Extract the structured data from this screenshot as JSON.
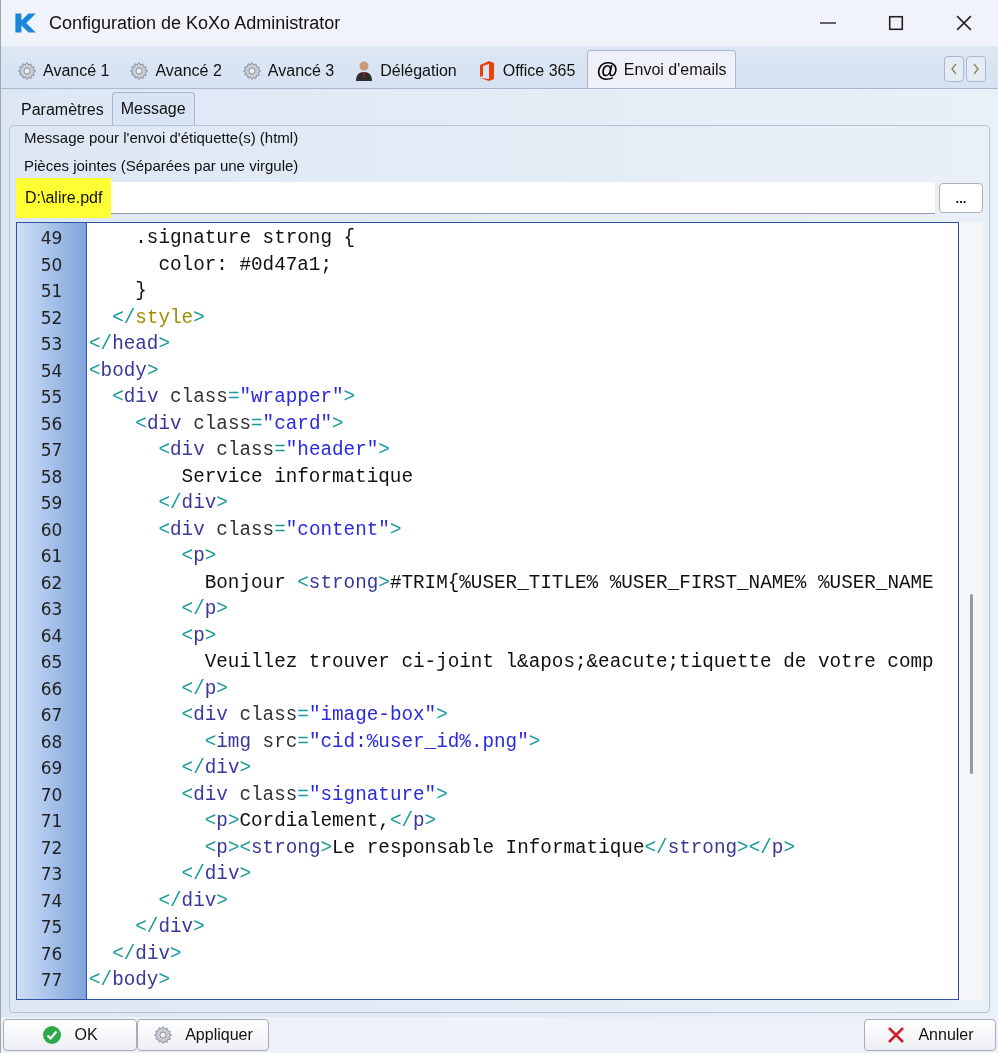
{
  "window": {
    "title": "Configuration de KoXo Administrator"
  },
  "tabs": [
    {
      "label": "Avancé 1",
      "selected": false
    },
    {
      "label": "Avancé 2",
      "selected": false
    },
    {
      "label": "Avancé 3",
      "selected": false
    },
    {
      "label": "Délégation",
      "selected": false
    },
    {
      "label": "Office 365",
      "selected": false
    },
    {
      "label": "Envoi d'emails",
      "symbol": "@",
      "selected": true
    }
  ],
  "subtabs": [
    {
      "label": "Paramètres",
      "selected": false
    },
    {
      "label": "Message",
      "selected": true
    }
  ],
  "group": {
    "title": "Message pour l'envoi d'étiquette(s) (html)"
  },
  "attachments": {
    "label": "Pièces jointes (Séparées par une virgule)",
    "value": "D:\\alire.pdf",
    "highlighted": true,
    "browse": "..."
  },
  "editor": {
    "lines": [
      {
        "n": "49",
        "kind": "markup",
        "text": "    .signature strong {"
      },
      {
        "n": "50",
        "kind": "markup",
        "text": "      color: #0d47a1;"
      },
      {
        "n": "51",
        "kind": "markup",
        "text": "    }"
      },
      {
        "n": "52",
        "kind": "style-tag",
        "text": "  </style>"
      },
      {
        "n": "53",
        "kind": "markup",
        "text": "</head>"
      },
      {
        "n": "54",
        "kind": "markup",
        "text": "<body>"
      },
      {
        "n": "55",
        "kind": "markup",
        "text": "  <div class=\"wrapper\">"
      },
      {
        "n": "56",
        "kind": "markup",
        "text": "    <div class=\"card\">"
      },
      {
        "n": "57",
        "kind": "markup",
        "text": "      <div class=\"header\">"
      },
      {
        "n": "58",
        "kind": "markup",
        "text": "        Service informatique"
      },
      {
        "n": "59",
        "kind": "markup",
        "text": "      </div>"
      },
      {
        "n": "60",
        "kind": "markup",
        "text": "      <div class=\"content\">"
      },
      {
        "n": "61",
        "kind": "markup",
        "text": "        <p>"
      },
      {
        "n": "62",
        "kind": "markup",
        "text": "          Bonjour <strong>#TRIM{%USER_TITLE% %USER_FIRST_NAME% %USER_NAME"
      },
      {
        "n": "63",
        "kind": "markup",
        "text": "        </p>"
      },
      {
        "n": "64",
        "kind": "markup",
        "text": "        <p>"
      },
      {
        "n": "65",
        "kind": "markup",
        "text": "          Veuillez trouver ci-joint l&apos;&eacute;tiquette de votre comp"
      },
      {
        "n": "66",
        "kind": "markup",
        "text": "        </p>"
      },
      {
        "n": "67",
        "kind": "markup",
        "text": "        <div class=\"image-box\">"
      },
      {
        "n": "68",
        "kind": "markup",
        "text": "          <img src=\"cid:%user_id%.png\">"
      },
      {
        "n": "69",
        "kind": "markup",
        "text": "        </div>"
      },
      {
        "n": "70",
        "kind": "markup",
        "text": "        <div class=\"signature\">"
      },
      {
        "n": "71",
        "kind": "markup",
        "text": "          <p>Cordialement,</p>"
      },
      {
        "n": "72",
        "kind": "markup",
        "text": "          <p><strong>Le responsable Informatique</strong></p>"
      },
      {
        "n": "73",
        "kind": "markup",
        "text": "        </div>"
      },
      {
        "n": "74",
        "kind": "markup",
        "text": "      </div>"
      },
      {
        "n": "75",
        "kind": "markup",
        "text": "    </div>"
      },
      {
        "n": "76",
        "kind": "markup",
        "text": "  </div>"
      },
      {
        "n": "77",
        "kind": "markup",
        "text": "</body>"
      }
    ]
  },
  "buttons": [
    {
      "label": "OK"
    },
    {
      "label": "Appliquer"
    },
    {
      "label": "Annuler"
    }
  ]
}
